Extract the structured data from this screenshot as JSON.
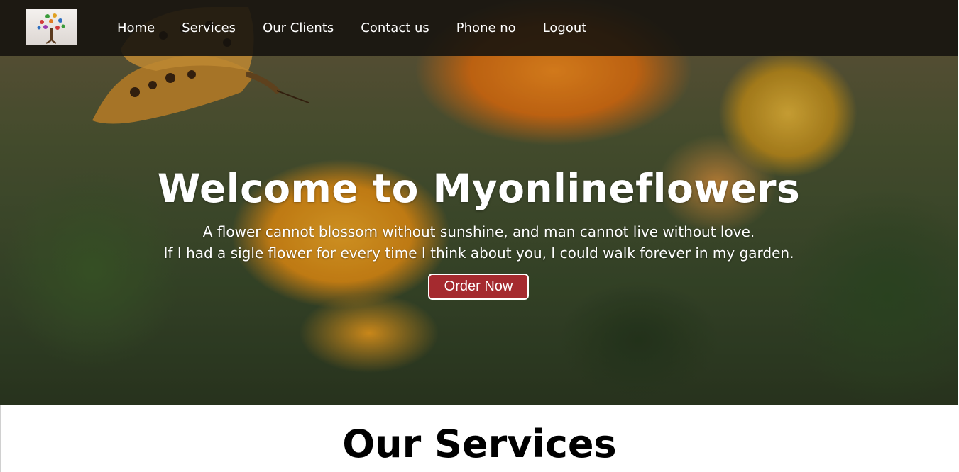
{
  "nav": {
    "logo_alt": "logo",
    "links": [
      "Home",
      "Services",
      "Our Clients",
      "Contact us",
      "Phone no",
      "Logout"
    ]
  },
  "hero": {
    "title": "Welcome to Myonlineflowers",
    "quote_line_1": "A flower cannot blossom without sunshine, and man cannot live without love.",
    "quote_line_2": "If I had a sigle flower for every time I think about you, I could walk forever in my garden.",
    "order_button": "Order Now"
  },
  "services": {
    "title": "Our Services"
  },
  "colors": {
    "navbar_bg": "#14120e",
    "order_button_bg": "#a52a2f",
    "text_light": "#ffffff",
    "text_dark": "#000000"
  }
}
